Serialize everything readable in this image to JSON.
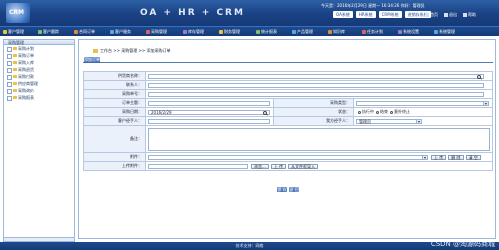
{
  "header": {
    "logo_text": "CRM",
    "app_title": "OA + HR + CRM",
    "time_line": "今天是：2016年2月29日  星期一  16:34:26  你好：管理员",
    "sys_tabs": [
      "OA系统",
      "HR系统",
      "CRM系统",
      "进销存系统"
    ],
    "top_links": [
      "首页",
      "退出",
      "帮助"
    ]
  },
  "menu": [
    {
      "label": "客户管理",
      "color": "#e8c24a"
    },
    {
      "label": "客户跟踪",
      "color": "#7fc16b"
    },
    {
      "label": "合同订单",
      "color": "#e08a3c"
    },
    {
      "label": "客户服务",
      "color": "#5aa6e0"
    },
    {
      "label": "采购管理",
      "color": "#d86464"
    },
    {
      "label": "库存管理",
      "color": "#9a7ad8"
    },
    {
      "label": "财务管理",
      "color": "#e8c24a"
    },
    {
      "label": "统计报表",
      "color": "#7fc16b"
    },
    {
      "label": "产品管理",
      "color": "#5aa6e0"
    },
    {
      "label": "知识库",
      "color": "#e08a3c"
    },
    {
      "label": "任务计划",
      "color": "#d86464"
    },
    {
      "label": "系统设置",
      "color": "#9a7ad8"
    },
    {
      "label": "系统管理",
      "color": "#5aa6e0"
    }
  ],
  "toolbar_right": [
    "工作台",
    "快捷",
    "收缩",
    "展开"
  ],
  "sidebar": {
    "title": "采购管理",
    "items": [
      "采购计划",
      "采购订单",
      "采购入库",
      "采购退货",
      "采购付款",
      "供应商管理",
      "采购询价",
      "采购报表"
    ]
  },
  "breadcrumb": "工作台 >> 采购管理 >> 添加采购订单",
  "tab_label": "添加订单",
  "form": {
    "supplier_label": "供货商名称：",
    "contact_label": "联系人：",
    "order_no_label": "采购单号：",
    "theme_label": "订单主题：",
    "type_label": "采购类型：",
    "date_label": "采购日期：",
    "date_value": "2016/2/29",
    "status_label": "状态：",
    "status_options": [
      "执行中",
      "结束",
      "意外终止"
    ],
    "handler_label": "我方经手人：",
    "handler_value": "管理员",
    "supplier_rep_label": "客户经手人：",
    "note_label": "备注：",
    "attach_label": "附件：",
    "attach_buttons": [
      "上 传",
      "删 除",
      "清 空"
    ],
    "upload_label": "上传附件：",
    "upload_buttons": [
      "浏览...",
      "上 传",
      "从文件柜导入"
    ]
  },
  "actions": [
    "保 存",
    "返 回"
  ],
  "status_bar": "技术支持：网络",
  "watermark": "CSDN @淘源码商城"
}
